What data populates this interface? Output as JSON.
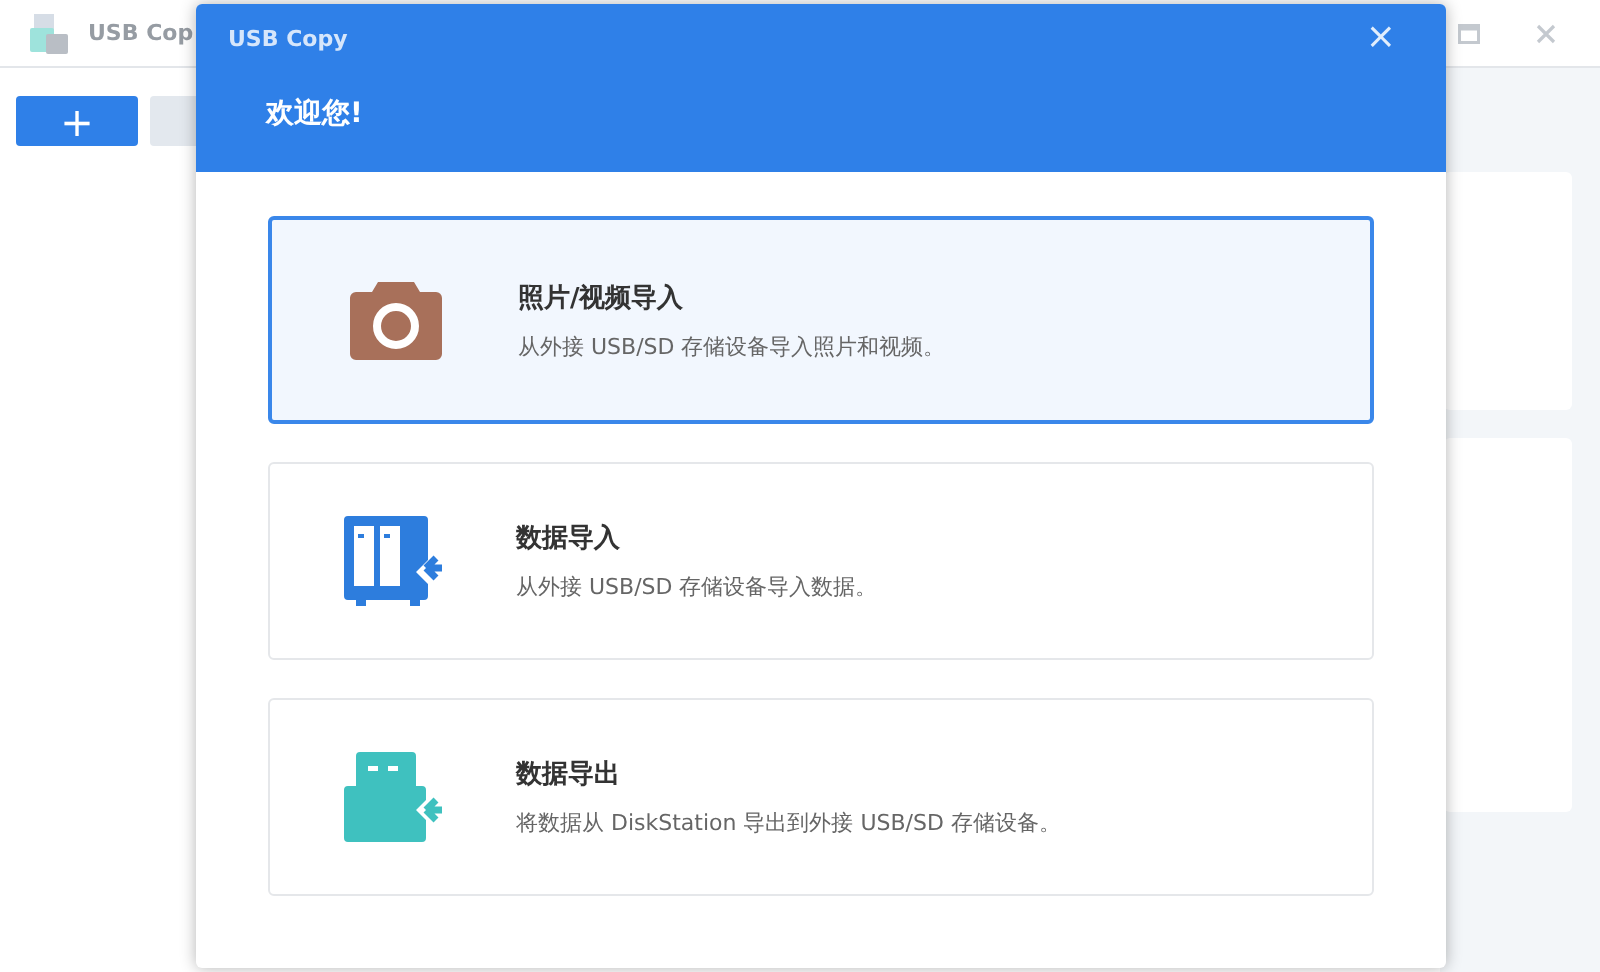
{
  "app": {
    "title": "USB Cop"
  },
  "toolbar": {
    "add_button": "+"
  },
  "dialog": {
    "title": "USB Copy",
    "close": "×",
    "heading": "欢迎您!",
    "options": [
      {
        "kind": "photo",
        "title": "照片/视频导入",
        "description": "从外接 USB/SD 存储设备导入照片和视频。",
        "selected": true
      },
      {
        "kind": "import",
        "title": "数据导入",
        "description": "从外接 USB/SD 存储设备导入数据。",
        "selected": false
      },
      {
        "kind": "export",
        "title": "数据导出",
        "description": "将数据从 DiskStation 导出到外接 USB/SD 存储设备。",
        "selected": false
      }
    ]
  }
}
